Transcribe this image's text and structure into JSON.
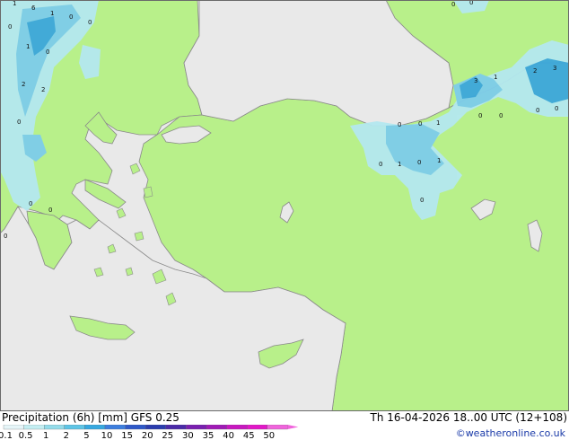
{
  "map": {
    "title": "Precipitation (6h) [mm] GFS 0.25",
    "valid_time": "Th 16-04-2026 18..00 UTC (12+108)",
    "credit": "©weatheronline.co.uk",
    "colors": {
      "land": "#b8f08a",
      "sea": "#e9e9e9",
      "coast": "#8a8a8a",
      "precip_light": "#b4e8f0",
      "precip_mid": "#7ecdea",
      "precip_high": "#3ca7dc"
    },
    "legend": {
      "ticks": [
        "0.1",
        "0.5",
        "1",
        "2",
        "5",
        "10",
        "15",
        "20",
        "25",
        "30",
        "35",
        "40",
        "45",
        "50"
      ],
      "colors": [
        "#e6f5f8",
        "#c4eef2",
        "#94dcea",
        "#5ec5e6",
        "#36a8e0",
        "#3c7ede",
        "#2e58c8",
        "#2a3cae",
        "#4a2aa8",
        "#7a1fb0",
        "#a01ab6",
        "#c818c0",
        "#e218c8",
        "#f064dc"
      ]
    },
    "point_labels": [
      "1",
      "6",
      "1",
      "0",
      "0",
      "0",
      "1",
      "0",
      "2",
      "2",
      "0",
      "0",
      "0",
      "0",
      "0",
      "0",
      "0",
      "3",
      "1",
      "2",
      "3",
      "0",
      "0",
      "0",
      "0",
      "0",
      "1",
      "0",
      "1",
      "0",
      "1",
      "0"
    ]
  }
}
